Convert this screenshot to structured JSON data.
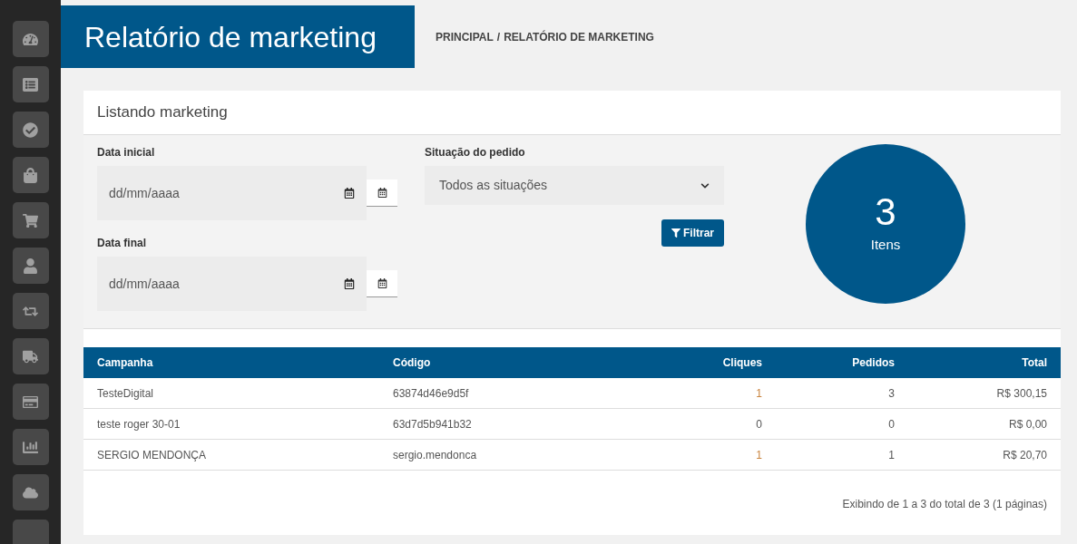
{
  "header": {
    "title": "Relatório de marketing",
    "breadcrumb_separator": "/",
    "breadcrumb": [
      {
        "label": "PRINCIPAL"
      },
      {
        "label": "RELATÓRIO DE MARKETING"
      }
    ]
  },
  "card": {
    "title": "Listando marketing"
  },
  "filters": {
    "date_start": {
      "label": "Data inicial",
      "placeholder": "dd/mm/aaaa"
    },
    "date_end": {
      "label": "Data final",
      "placeholder": "dd/mm/aaaa"
    },
    "status": {
      "label": "Situação do pedido",
      "value": "Todos as situações"
    },
    "button": "Filtrar"
  },
  "summary": {
    "count": "3",
    "unit": "Itens"
  },
  "table": {
    "columns": [
      "Campanha",
      "Código",
      "Cliques",
      "Pedidos",
      "Total"
    ],
    "rows": [
      {
        "campaign": "TesteDigital",
        "code": "63874d46e9d5f",
        "clicks": "1",
        "clicks_linked": true,
        "orders": "3",
        "total": "R$ 300,15"
      },
      {
        "campaign": "teste roger 30-01",
        "code": "63d7d5b941b32",
        "clicks": "0",
        "clicks_linked": false,
        "orders": "0",
        "total": "R$ 0,00"
      },
      {
        "campaign": "SERGIO MENDONÇA",
        "code": "sergio.mendonca",
        "clicks": "1",
        "clicks_linked": true,
        "orders": "1",
        "total": "R$ 20,70"
      }
    ]
  },
  "pagination": "Exibindo de 1 a 3 do total de 3 (1 páginas)"
}
